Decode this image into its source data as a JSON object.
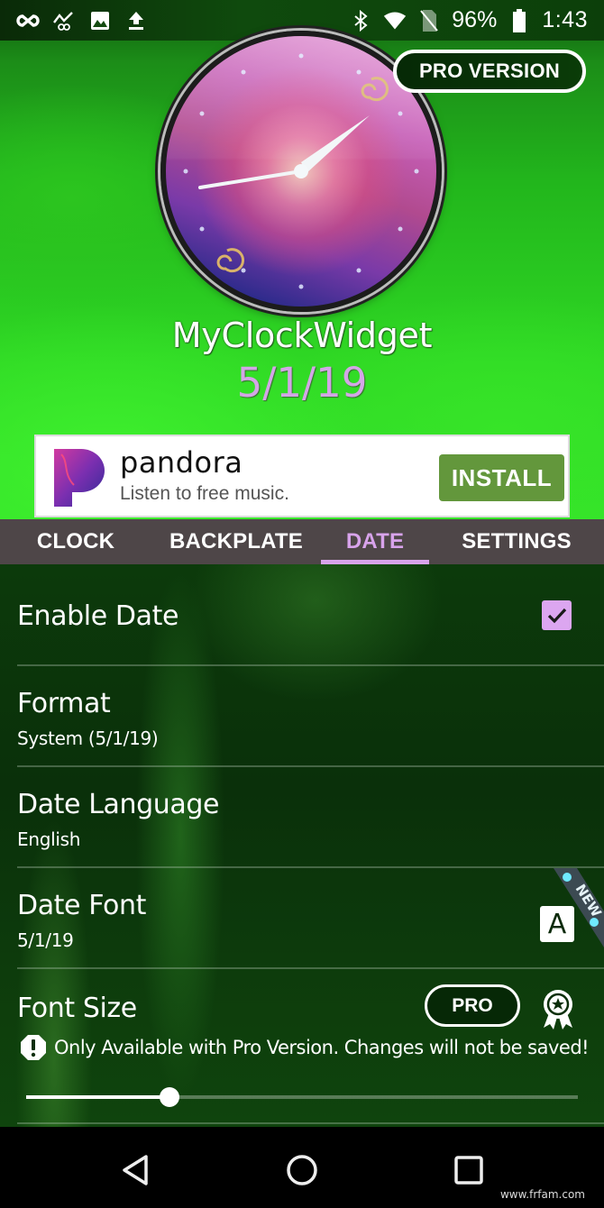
{
  "status_bar": {
    "left_icons": [
      "infinity-icon",
      "analytics-icon",
      "image-icon",
      "upload-icon"
    ],
    "right_icons": [
      "bluetooth-icon",
      "wifi-icon",
      "no-sim-icon",
      "battery-icon"
    ],
    "battery_percent": "96%",
    "time": "1:43"
  },
  "header": {
    "pro_version_label": "PRO VERSION",
    "app_name": "MyClockWidget",
    "date_preview": "5/1/19",
    "clock_preview": {
      "hour_hand_time": "1:43"
    }
  },
  "ad": {
    "brand": "pandora",
    "tagline": "Listen to free music.",
    "install_label": "INSTALL"
  },
  "tabs": [
    {
      "label": "CLOCK",
      "active": false
    },
    {
      "label": "BACKPLATE",
      "active": false
    },
    {
      "label": "DATE",
      "active": true
    },
    {
      "label": "SETTINGS",
      "active": false
    }
  ],
  "settings": {
    "enable_date": {
      "title": "Enable Date",
      "checked": true
    },
    "format": {
      "title": "Format",
      "value": "System (5/1/19)"
    },
    "date_language": {
      "title": "Date Language",
      "value": "English"
    },
    "date_font": {
      "title": "Date Font",
      "value": "5/1/19",
      "icon_letter": "A",
      "badge": "NEW"
    },
    "font_size": {
      "title": "Font Size",
      "pro_label": "PRO",
      "warning": "Only Available with Pro Version. Changes will not be saved!",
      "slider_value_fraction": 0.26
    }
  },
  "colors": {
    "accent": "#d8a3eb",
    "tab_bar_bg": "#4e4648",
    "install_green": "#63973c"
  },
  "nav_bar": {
    "buttons": [
      "back",
      "home",
      "recents"
    ]
  },
  "watermark": "www.frfam.com"
}
